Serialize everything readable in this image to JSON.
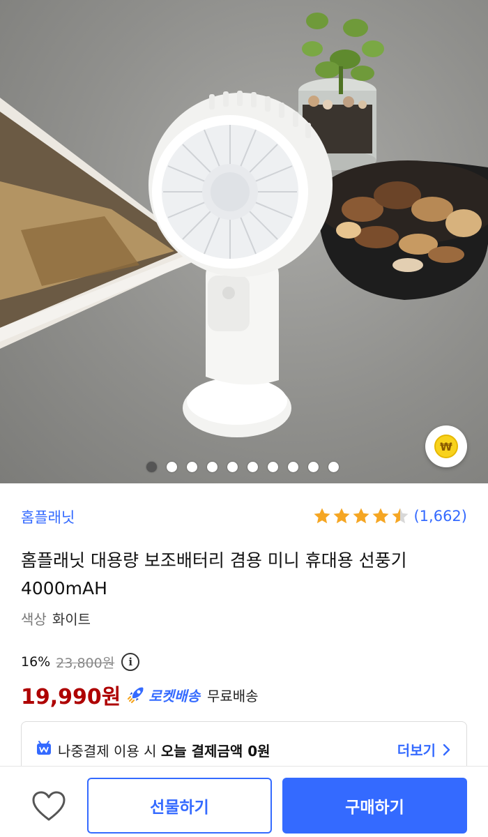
{
  "colors": {
    "accent": "#346aff",
    "price": "#ae0000",
    "star": "#f5a623"
  },
  "gallery": {
    "total_images": 10,
    "active_index": 0
  },
  "product": {
    "brand": "홈플래닛",
    "rating": 4.5,
    "review_count": "(1,662)",
    "title": "홈플래닛 대용량 보조배터리 겸용 미니 휴대용 선풍기 4000mAH",
    "option_key": "색상",
    "option_value": "화이트",
    "discount": "16%",
    "original_price": "23,800원",
    "price": "19,990원",
    "rocket_label": "로켓배송",
    "shipping": "무료배송",
    "info_icon": "i"
  },
  "pay_later": {
    "text_prefix": "나중결제 이용 시",
    "text_bold": "오늘 결제금액 0원",
    "more_label": "더보기"
  },
  "bottom_bar": {
    "gift_label": "선물하기",
    "buy_label": "구매하기"
  },
  "icons": {
    "coin": "₩",
    "heart": "heart-icon",
    "rocket": "rocket-icon",
    "chevron": "chevron-right-icon"
  }
}
